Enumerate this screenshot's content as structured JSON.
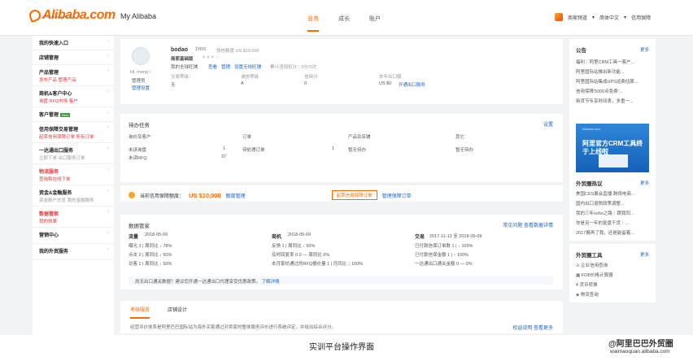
{
  "header": {
    "logo": "Alibaba.com",
    "logo_tagline": "Global trade starts here.",
    "title": "My Alibaba",
    "tabs": [
      {
        "label": "业务"
      },
      {
        "label": "成长"
      },
      {
        "label": "账户"
      }
    ],
    "right": {
      "store": "商家频道",
      "lang": "简体中文",
      "guarantee": "信用保障"
    }
  },
  "leftnav": [
    {
      "title": "我的快速入口",
      "sub": "",
      "sub2": ""
    },
    {
      "title": "店铺管理",
      "sub": "",
      "sub2": ""
    },
    {
      "title": "产品管理",
      "sub": "发布产品",
      "sub2": "管理产品"
    },
    {
      "title": "商机&客户中心",
      "sub": "询盘",
      "sub2": "RFQ市场",
      "sub3": "客户"
    },
    {
      "title": "客户管理",
      "badge": "New",
      "sub": "",
      "sub2": ""
    },
    {
      "title": "信用保障交易管理",
      "sub": "起草信用保障订单",
      "sub2": "所有订单"
    },
    {
      "title": "一达通出口服务",
      "sub": "立即下单",
      "sub2": "出口服务订单",
      "gray": true
    },
    {
      "title": "物流服务",
      "sub": "查询和在线下单",
      "sub2": ""
    },
    {
      "title": "资金&金融服务",
      "sub": "资金账户总览",
      "sub2": "我的金融服务",
      "gray": true
    },
    {
      "title": "数据管家",
      "sub": "我的效果",
      "sub2": ""
    },
    {
      "title": "营销中心",
      "sub": "",
      "sub2": ""
    },
    {
      "title": "我的外贸服务",
      "sub": "",
      "sub2": ""
    }
  ],
  "profile": {
    "name": "bodao",
    "years": "1YRS",
    "limit": "授信额度 US $10,000",
    "shop": "商家基础版",
    "greeting": "Hi, meng l",
    "role1": "管理员",
    "role2": "管理设置",
    "links_label": "我的全球旺铺",
    "link1": "查看",
    "link2": "管理",
    "link3": "设置无线旺铺",
    "score": "累计违规扣分：0分/0次",
    "cols": [
      {
        "label": "交易等级：",
        "value": "无"
      },
      {
        "label": "诚信等级",
        "value": "A"
      },
      {
        "label": "信用分",
        "value": "0"
      },
      {
        "label": "本年出口额",
        "value": "US $0",
        "link": "开通出口服务"
      }
    ]
  },
  "tasks": {
    "title": "待办任务",
    "settings": "设置",
    "headers": [
      "询价及客户",
      "订单",
      "产品及店铺",
      "其它"
    ],
    "rows": [
      {
        "c1": "未读询盘",
        "v1": "1",
        "c2": "待处理订单",
        "v2": "1",
        "c3": "暂无待办",
        "c4": "暂无待办"
      },
      {
        "c1": "未读RFQ",
        "v1": "37",
        "c2": "",
        "v2": "",
        "c3": "",
        "c4": ""
      }
    ]
  },
  "guarantee": {
    "label": "当前信用保障额度：",
    "amount": "US $10,000",
    "link1": "额度管理",
    "btn1": "起草信用保障订单",
    "link2": "管理保障订单"
  },
  "stats": {
    "title": "数据管家",
    "links": "常见问题 查看数据详情",
    "groups": [
      {
        "name": "流量",
        "date": "2018-05-09",
        "rows": [
          "曝光 3 | 周同比 ↓ 78%",
          "点击 2 | 周同比 ↓ 50%",
          "访客 1 | 周同比 ↓ 50%"
        ]
      },
      {
        "name": "商机",
        "date": "2018-05-09",
        "rows": [
          "反馈 1 | 周同比 ↓ 50%",
          "及时回复率 0.0 — 周同比 0%",
          "本月家纺通过的RFQ报价量 1 | 月同比 ↓ 100%"
        ]
      },
      {
        "name": "交易",
        "date": "2017-11-13 至 2018-05-09",
        "rows": [
          "已付款信保订单数 1 | ↓ 100%",
          "已付款信保金额 1 | ↑ 100%",
          "一达通出口通关金额 0 — 0%"
        ]
      }
    ],
    "notice": "尚无出口通关数据？建议您开通一达通出口代理享受优惠政策。",
    "notice_link": "了解详情"
  },
  "bottom": {
    "tabs": [
      "考核服务",
      "店铺设计"
    ],
    "text": "经营评价体系是阿里巴巴国际站为海外买家通过对卖家的整体服务评价进行系统评定，并给出综合评分。",
    "links": "权益说明 查看更多"
  },
  "right": {
    "notice": {
      "title": "公告",
      "more": "更多",
      "items": [
        "福利｜阿里CRM工具一客户...",
        "阿里国际站推出新功能...",
        "阿里国际站集成UPS运费估算...",
        "信用保障'5000点免费'...",
        "新货节专享时间表，多重一..."
      ]
    },
    "banner": {
      "t1": "Alibaba.com",
      "t2": "阿里官方CRM工具终于上线啦"
    },
    "hot": {
      "title": "外贸圈热议",
      "more": "更多",
      "items": [
        "美国CES展会直播 跨境电商...",
        "国内出口退税政策调整...",
        "我的三年soho之路｜跟我同...",
        "你是另一年的复盘干货｜...",
        "2017展再了我，还是能留着..."
      ]
    },
    "tools": {
      "title": "外贸圈工具",
      "more": "更多",
      "items": [
        "企业信用查询",
        "FOB价格计算器",
        "货币转换",
        "物流查询"
      ]
    }
  },
  "caption": "实训平台操作界面",
  "watermark": {
    "line1": "@阿里巴巴外贸圈",
    "line2": "waimaoquan.alibaba.com"
  }
}
